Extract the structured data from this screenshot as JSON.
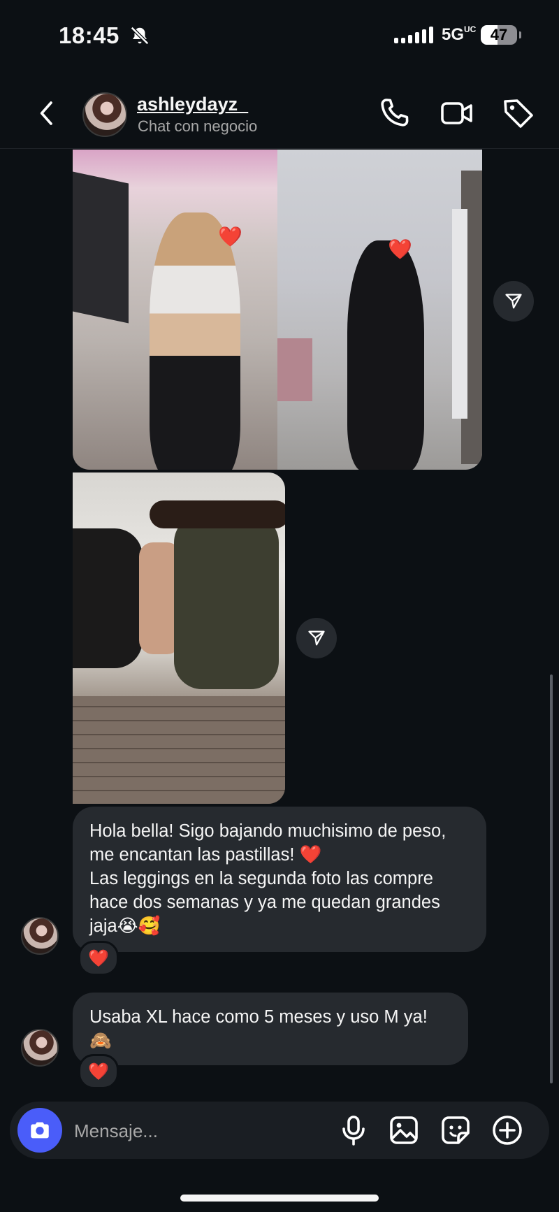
{
  "status_bar": {
    "time": "18:45",
    "network": "5G",
    "network_suffix": "UC",
    "battery": "47"
  },
  "header": {
    "username": "ashleydayz_",
    "subtitle": "Chat con negocio"
  },
  "messages": [
    {
      "text": "Hola bella! Sigo bajando muchisimo de peso, me encantan las pastillas! ❤️\nLas leggings en la segunda foto las compre hace dos semanas y ya me quedan grandes jaja😭🥰",
      "reaction": "❤️"
    },
    {
      "text": "Usaba XL hace como 5 meses y uso M ya! 🙈",
      "reaction": "❤️"
    }
  ],
  "composer": {
    "placeholder": "Mensaje..."
  },
  "photo_hearts": [
    "❤️",
    "❤️"
  ],
  "icons": [
    "bell-slash-icon",
    "back-arrow-icon",
    "phone-icon",
    "video-icon",
    "tag-icon",
    "share-icon",
    "camera-icon",
    "microphone-icon",
    "gallery-icon",
    "sticker-icon",
    "plus-icon"
  ],
  "colors": {
    "background": "#0c1014",
    "bubble": "#262a2f",
    "camera_button": "#4a5df9",
    "heart": "#e0245e"
  }
}
